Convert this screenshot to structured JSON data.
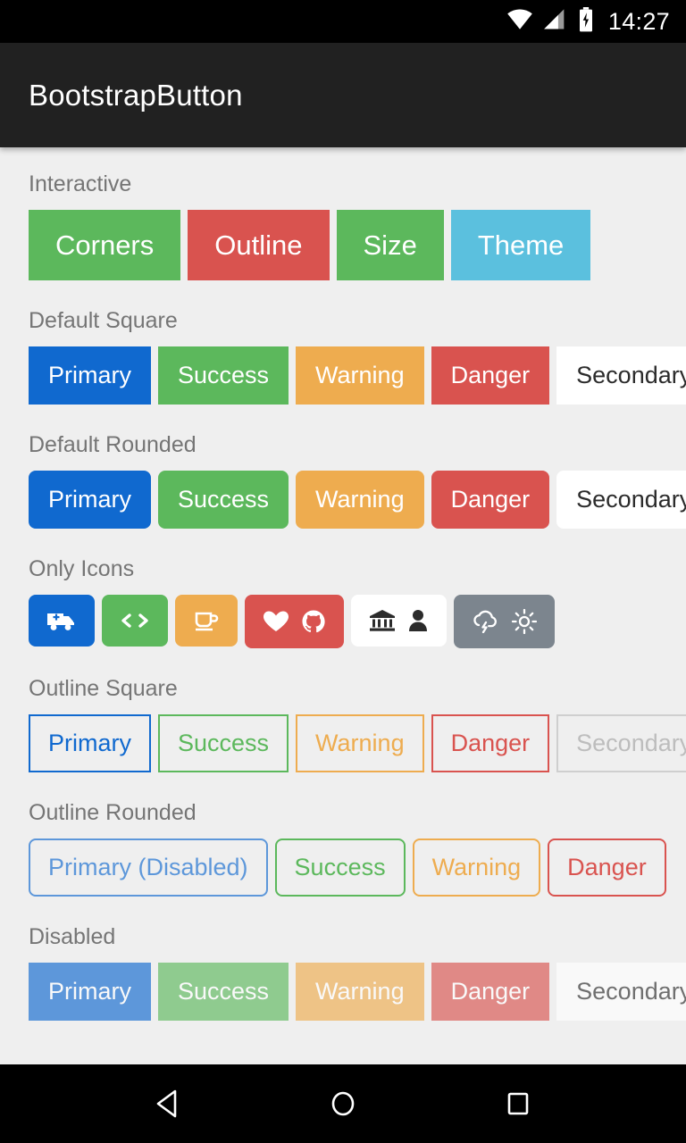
{
  "status_bar": {
    "time": "14:27",
    "icons": [
      "wifi-icon",
      "cellular-signal-icon",
      "battery-charging-icon"
    ]
  },
  "app_bar": {
    "title": "BootstrapButton"
  },
  "colors": {
    "background": "#efefef",
    "app_bar": "#212121",
    "label": "#757575",
    "primary": "#1069cf",
    "success": "#5cb85c",
    "warning": "#eeac4f",
    "danger": "#d9534f",
    "secondary": "#ffffff",
    "info": "#5bc0de",
    "dark": "#7c858e"
  },
  "sections": [
    {
      "label": "Interactive",
      "buttons": [
        {
          "label": "Corners",
          "variant": "success"
        },
        {
          "label": "Outline",
          "variant": "danger"
        },
        {
          "label": "Size",
          "variant": "success"
        },
        {
          "label": "Theme",
          "variant": "info"
        }
      ]
    },
    {
      "label": "Default Square",
      "buttons": [
        {
          "label": "Primary",
          "variant": "primary"
        },
        {
          "label": "Success",
          "variant": "success"
        },
        {
          "label": "Warning",
          "variant": "warning"
        },
        {
          "label": "Danger",
          "variant": "danger"
        },
        {
          "label": "Secondary",
          "variant": "secondary"
        }
      ]
    },
    {
      "label": "Default Rounded",
      "buttons": [
        {
          "label": "Primary",
          "variant": "primary"
        },
        {
          "label": "Success",
          "variant": "success"
        },
        {
          "label": "Warning",
          "variant": "warning"
        },
        {
          "label": "Danger",
          "variant": "danger"
        },
        {
          "label": "Secondary",
          "variant": "secondary"
        }
      ]
    },
    {
      "label": "Only Icons",
      "icon_buttons": [
        {
          "variant": "primary",
          "icons": [
            "ambulance-icon"
          ]
        },
        {
          "variant": "success",
          "icons": [
            "code-icon"
          ]
        },
        {
          "variant": "warning",
          "icons": [
            "coffee-icon"
          ]
        },
        {
          "variant": "danger",
          "icons": [
            "heart-icon",
            "github-icon"
          ]
        },
        {
          "variant": "secondary",
          "icons": [
            "bank-icon",
            "user-icon"
          ]
        },
        {
          "variant": "dark",
          "icons": [
            "cloud-lightning-icon",
            "sun-icon"
          ]
        }
      ]
    },
    {
      "label": "Outline Square",
      "buttons": [
        {
          "label": "Primary",
          "variant": "primary"
        },
        {
          "label": "Success",
          "variant": "success"
        },
        {
          "label": "Warning",
          "variant": "warning"
        },
        {
          "label": "Danger",
          "variant": "danger"
        },
        {
          "label": "Secondary",
          "variant": "secondary"
        }
      ]
    },
    {
      "label": "Outline Rounded",
      "buttons": [
        {
          "label": "Primary (Disabled)",
          "variant": "primary"
        },
        {
          "label": "Success",
          "variant": "success"
        },
        {
          "label": "Warning",
          "variant": "warning"
        },
        {
          "label": "Danger",
          "variant": "danger"
        }
      ]
    },
    {
      "label": "Disabled",
      "buttons": [
        {
          "label": "Primary",
          "variant": "primary"
        },
        {
          "label": "Success",
          "variant": "success"
        },
        {
          "label": "Warning",
          "variant": "warning"
        },
        {
          "label": "Danger",
          "variant": "danger"
        },
        {
          "label": "Secondary",
          "variant": "secondary"
        }
      ]
    }
  ],
  "nav_bar": {
    "buttons": [
      "back-icon",
      "home-icon",
      "recents-icon"
    ]
  }
}
